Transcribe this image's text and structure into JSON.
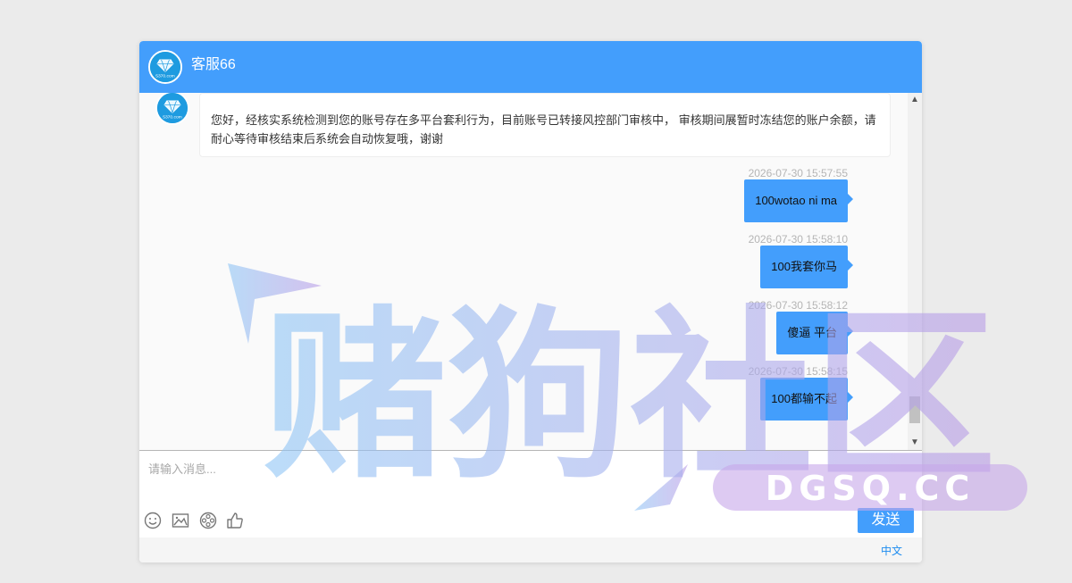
{
  "header": {
    "title": "客服66",
    "avatar_text": "5370.com"
  },
  "agent_message": {
    "text": "您好，经核实系统检测到您的账号存在多平台套利行为，目前账号已转接风控部门审核中， 审核期间展暂时冻结您的账户余额，请耐心等待审核结束后系统会自动恢复哦，谢谢"
  },
  "messages": [
    {
      "time": "2026-07-30 15:57:55",
      "text": "100wotao ni ma"
    },
    {
      "time": "2026-07-30 15:58:10",
      "text": "100我套你马"
    },
    {
      "time": "2026-07-30 15:58:12",
      "text": "傻逼 平台"
    },
    {
      "time": "2026-07-30 15:58:15",
      "text": "100都输不起"
    }
  ],
  "composer": {
    "placeholder": "请输入消息...",
    "send_label": "发送"
  },
  "toolbar": [
    "emoji-icon",
    "image-icon",
    "film-reel-icon",
    "thumbs-up-icon"
  ],
  "footer": {
    "language": "中文"
  },
  "watermark": {
    "text": "赌狗社区",
    "domain": "DGSQ.CC"
  },
  "colors": {
    "accent": "#439efc",
    "link": "#1d8cf0"
  }
}
